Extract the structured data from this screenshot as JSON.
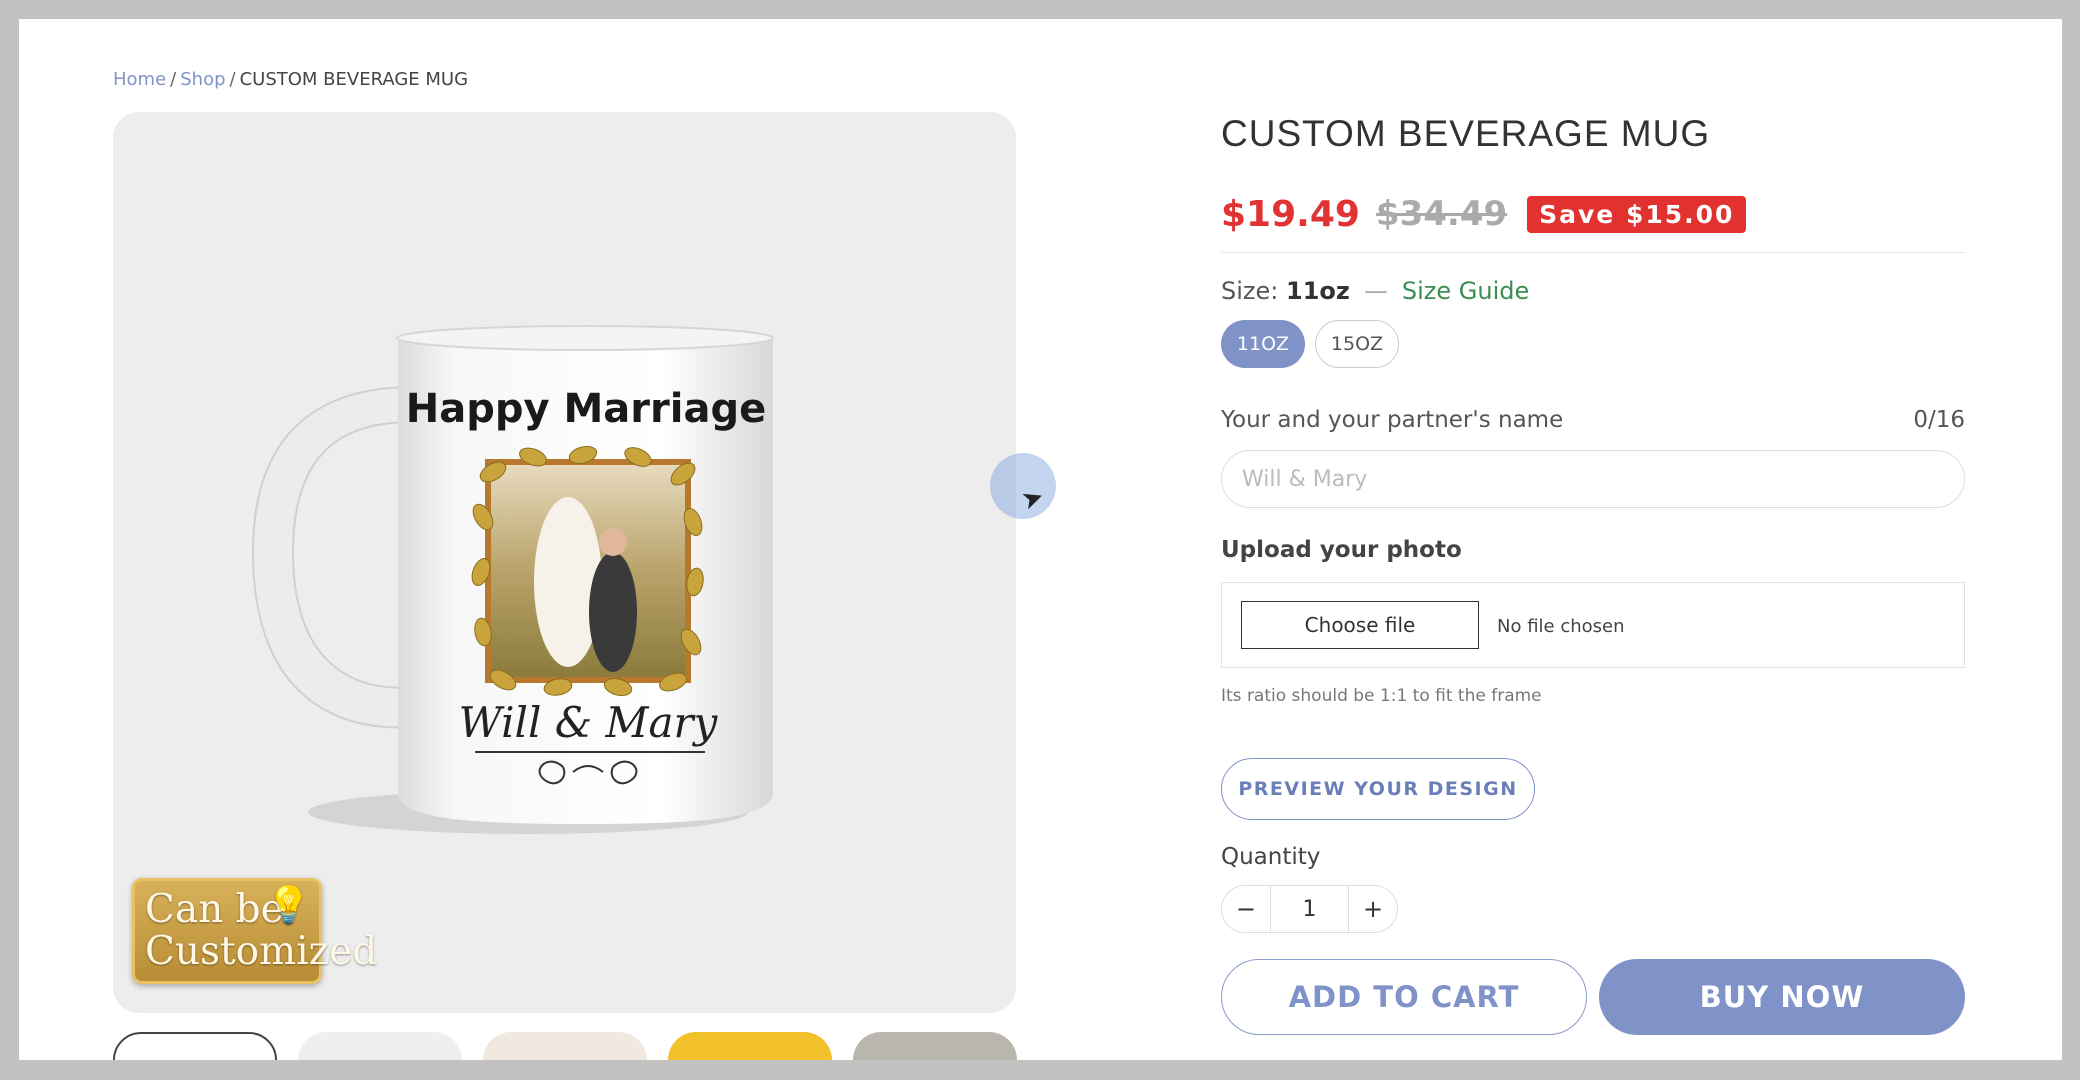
{
  "breadcrumb": {
    "home": "Home",
    "shop": "Shop",
    "sep": "/",
    "current": "CUSTOM BEVERAGE MUG"
  },
  "product": {
    "title": "CUSTOM BEVERAGE MUG",
    "price_sale": "$19.49",
    "price_regular": "$34.49",
    "save_label": "Save $15.00",
    "size_label": "Size:",
    "size_value": "11oz",
    "size_dash": "—",
    "size_guide": "Size Guide",
    "size_options": [
      "11OZ",
      "15OZ"
    ],
    "selected_size": "11OZ"
  },
  "personalize": {
    "name_label": "Your and your partner's name",
    "name_count": "0/16",
    "name_placeholder": "Will & Mary",
    "upload_label": "Upload your photo",
    "choose_file": "Choose file",
    "no_file": "No file chosen",
    "ratio_hint": "Its ratio should be 1:1 to fit the frame",
    "preview_button": "PREVIEW YOUR DESIGN"
  },
  "quantity": {
    "label": "Quantity",
    "value": "1",
    "minus": "−",
    "plus": "+"
  },
  "actions": {
    "add_to_cart": "ADD TO CART",
    "buy_now": "BUY NOW"
  },
  "mug_print": {
    "headline": "Happy Marriage",
    "names": "Will & Mary"
  },
  "badge": {
    "line1": "Can be",
    "line2": "Customized",
    "icon": "lightbulb-icon"
  },
  "colors": {
    "accent": "#7f93c8",
    "sale": "#e23333",
    "guide": "#3b8e52"
  }
}
